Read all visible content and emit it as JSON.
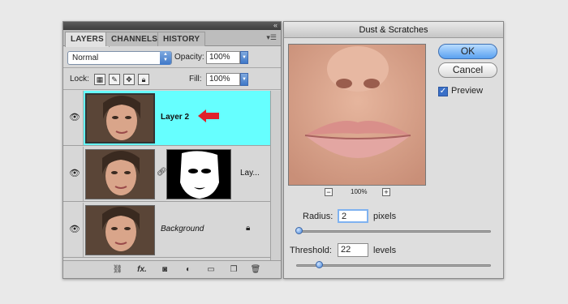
{
  "layers_panel": {
    "tabs": [
      "LAYERS",
      "CHANNELS",
      "HISTORY"
    ],
    "blend_mode": "Normal",
    "opacity_label": "Opacity:",
    "opacity_value": "100%",
    "lock_label": "Lock:",
    "fill_label": "Fill:",
    "fill_value": "100%",
    "layers": [
      {
        "name": "Layer 2",
        "selected": true
      },
      {
        "name": "Lay...",
        "selected": false
      },
      {
        "name": "Background",
        "selected": false
      }
    ],
    "footer_icons": [
      "link-icon",
      "fx-icon",
      "mask-icon",
      "adjustment-icon",
      "folder-icon",
      "new-layer-icon",
      "trash-icon"
    ],
    "fx_label": "fx."
  },
  "dialog": {
    "title": "Dust & Scratches",
    "ok_label": "OK",
    "cancel_label": "Cancel",
    "preview_label": "Preview",
    "preview_checked": true,
    "zoom_level": "100%",
    "zoom_out": "−",
    "zoom_in": "+",
    "radius_label": "Radius:",
    "radius_value": "2",
    "radius_unit": "pixels",
    "threshold_label": "Threshold:",
    "threshold_value": "22",
    "threshold_unit": "levels"
  },
  "colors": {
    "selected_layer": "#66ffff",
    "arrow": "#e0202a",
    "accent": "#4a88d8"
  }
}
